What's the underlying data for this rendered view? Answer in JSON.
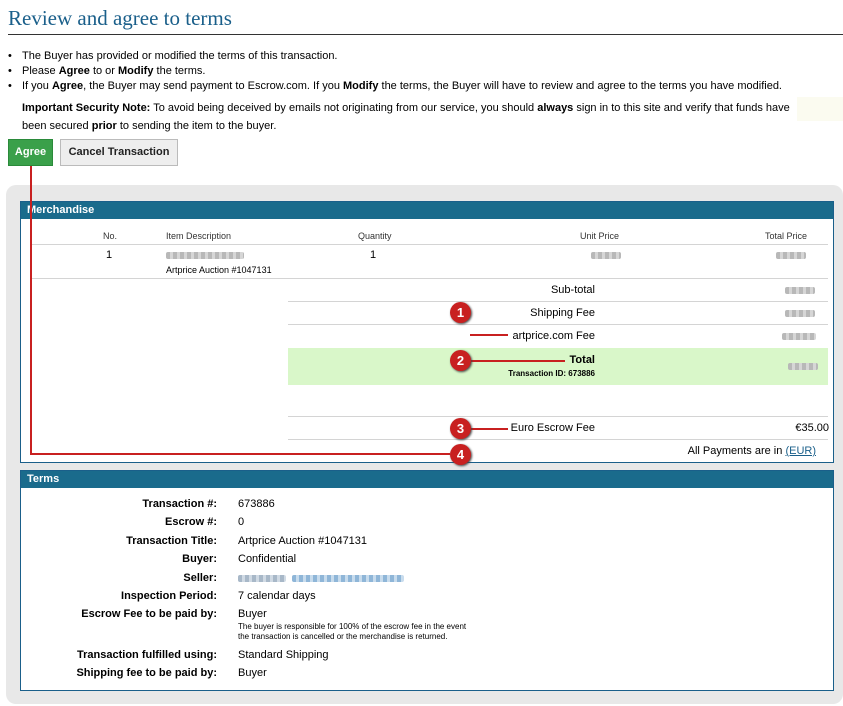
{
  "page": {
    "title": "Review and agree to terms"
  },
  "bullets": [
    {
      "text": "The Buyer has provided or modified the terms of this transaction."
    },
    {
      "pre": "Please ",
      "b1": "Agree",
      "mid": " to or ",
      "b2": "Modify",
      "post": " the terms."
    },
    {
      "pre": "If you ",
      "b1": "Agree",
      "mid": ", the Buyer may send payment to Escrow.com. If you ",
      "b2": "Modify",
      "post": " the terms, the Buyer will have to review and agree to the terms you have modified."
    }
  ],
  "security_note": {
    "label": "Important Security Note:",
    "text1": " To avoid being deceived by emails not originating from our service, you should ",
    "always": "always",
    "text2": " sign in to this site and verify that funds have been secured ",
    "prior": "prior",
    "text3": " to sending the item to the buyer."
  },
  "buttons": {
    "agree": "Agree",
    "cancel": "Cancel Transaction"
  },
  "merchandise": {
    "heading": "Merchandise",
    "columns": {
      "no": "No.",
      "desc": "Item Description",
      "qty": "Quantity",
      "unit": "Unit Price",
      "total": "Total Price"
    },
    "item": {
      "no": "1",
      "desc_line2": "Artprice Auction #1047131",
      "qty": "1"
    },
    "subtotal_label": "Sub-total",
    "shipping_label": "Shipping Fee",
    "artprice_label": "artprice.com Fee",
    "total_label": "Total",
    "transaction_id_label": "Transaction ID: 673886",
    "euro_escrow_label": "Euro Escrow Fee",
    "euro_escrow_value": "€35.00",
    "payments_pre": "All Payments are in ",
    "payments_link": "(EUR)"
  },
  "annotations": [
    "1",
    "2",
    "3",
    "4"
  ],
  "terms": {
    "heading": "Terms",
    "rows": [
      {
        "label": "Transaction #:",
        "value": "673886"
      },
      {
        "label": "Escrow #:",
        "value": "0"
      },
      {
        "label": "Transaction Title:",
        "value": "Artprice Auction #1047131"
      },
      {
        "label": "Buyer:",
        "value": "Confidential"
      },
      {
        "label": "Seller:",
        "value": ""
      },
      {
        "label": "Inspection Period:",
        "value": "7 calendar days"
      },
      {
        "label": "Escrow Fee to be paid by:",
        "value": "Buyer"
      },
      {
        "label": "Transaction fulfilled using:",
        "value": "Standard Shipping"
      },
      {
        "label": "Shipping fee to be paid by:",
        "value": "Buyer"
      }
    ],
    "escrow_fee_note_1": "The buyer is responsible for 100% of the escrow fee in the event",
    "escrow_fee_note_2": "the transaction is cancelled or the merchandise is returned."
  },
  "colors": {
    "title": "#1a5f8a",
    "header_bar": "#1a6b8c",
    "agree_button": "#3aa04a",
    "total_row": "#d9f7c9",
    "annotation": "#c82020"
  }
}
